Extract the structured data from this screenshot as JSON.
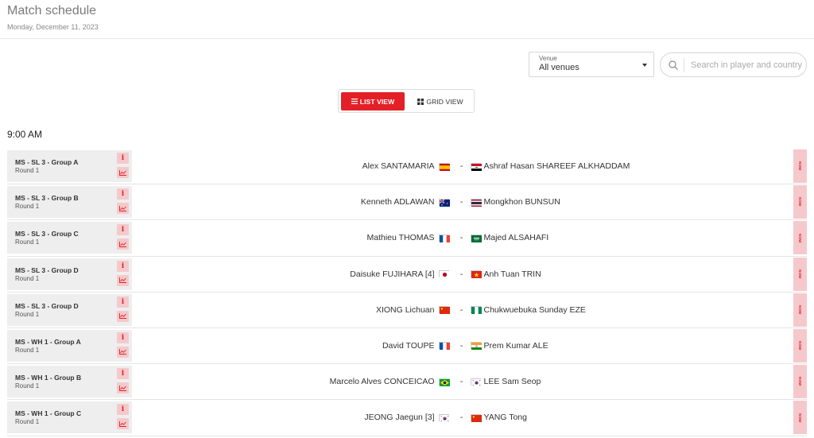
{
  "header": {
    "title": "Match schedule",
    "date": "Monday, December 11, 2023"
  },
  "venue": {
    "label": "Venue",
    "value": "All venues"
  },
  "search": {
    "placeholder": "Search in player and country"
  },
  "view_toggle": {
    "list_label": "LIST VIEW",
    "grid_label": "GRID VIEW"
  },
  "time_heading": "9:00 AM",
  "colors": {
    "accent": "#e32027",
    "accent_light": "#f5c9cc"
  },
  "matches": [
    {
      "event": "MS - SL 3 - Group A",
      "round": "Round 1",
      "player1": "Alex SANTAMARIA",
      "flag1": "spain",
      "player2": "Ashraf Hasan SHAREEF ALKHADDAM",
      "flag2": "iraq",
      "status": "NOW"
    },
    {
      "event": "MS - SL 3 - Group B",
      "round": "Round 1",
      "player1": "Kenneth ADLAWAN",
      "flag1": "australia",
      "player2": "Mongkhon BUNSUN",
      "flag2": "thailand",
      "status": "NOW"
    },
    {
      "event": "MS - SL 3 - Group C",
      "round": "Round 1",
      "player1": "Mathieu THOMAS",
      "flag1": "france",
      "player2": "Majed ALSAHAFI",
      "flag2": "saudi-arabia",
      "status": "NOW"
    },
    {
      "event": "MS - SL 3 - Group D",
      "round": "Round 1",
      "player1": "Daisuke FUJIHARA [4]",
      "flag1": "japan",
      "player2": "Anh Tuan TRIN",
      "flag2": "vietnam",
      "status": "NOW"
    },
    {
      "event": "MS - SL 3 - Group D",
      "round": "Round 1",
      "player1": "XIONG Lichuan",
      "flag1": "china",
      "player2": "Chukwuebuka Sunday EZE",
      "flag2": "nigeria",
      "status": "NOW"
    },
    {
      "event": "MS - WH 1 - Group A",
      "round": "Round 1",
      "player1": "David TOUPE",
      "flag1": "france",
      "player2": "Prem Kumar ALE",
      "flag2": "india",
      "status": "NOW"
    },
    {
      "event": "MS - WH 1 - Group B",
      "round": "Round 1",
      "player1": "Marcelo Alves CONCEICAO",
      "flag1": "brazil",
      "player2": "LEE Sam Seop",
      "flag2": "korea",
      "status": "NOW"
    },
    {
      "event": "MS - WH 1 - Group C",
      "round": "Round 1",
      "player1": "JEONG Jaegun [3]",
      "flag1": "korea",
      "player2": "YANG Tong",
      "flag2": "china",
      "status": "NOW"
    }
  ]
}
